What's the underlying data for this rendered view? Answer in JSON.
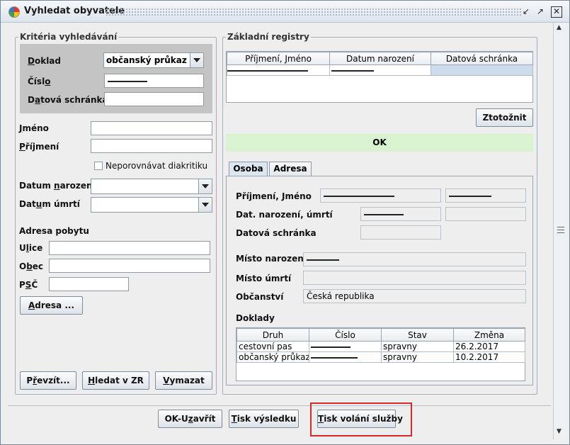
{
  "window": {
    "title": "Vyhledat obyvatele",
    "controls": [
      "minimize-icon",
      "restore-icon",
      "close-icon"
    ]
  },
  "criteria": {
    "legend": "Kritéria vyhledávání",
    "doklad_label": "Doklad",
    "doklad_value": "občanský průkaz",
    "cislo_label": "Číslo",
    "cislo_value": "[redacted]",
    "datova_schranka_label": "Datová schránka",
    "datova_schranka_value": "",
    "jmeno_label": "Jméno",
    "jmeno_value": "",
    "prijmeni_label": "Příjmení",
    "prijmeni_value": "",
    "diakritika_label": "Neporovnávat diakritiku",
    "diakritika_checked": false,
    "datum_narozeni_label": "Datum narození",
    "datum_narozeni_value": "",
    "datum_umrti_label": "Datum úmrtí",
    "datum_umrti_value": "",
    "adresa_pobytu_label": "Adresa pobytu",
    "ulice_label": "Ulice",
    "ulice_value": "",
    "obec_label": "Obec",
    "obec_value": "",
    "psc_label": "PSČ",
    "psc_value": "",
    "adresa_button": "Adresa ...",
    "prevzit_button": "Převzít...",
    "hledat_button": "Hledat v ZR",
    "vymazat_button": "Vymazat"
  },
  "registry": {
    "legend": "Základní registry",
    "columns": [
      "Příjmení, Jméno",
      "Datum narození",
      "Datová schránka"
    ],
    "rows": [
      {
        "name": "[redacted]",
        "birth": "[redacted]",
        "box": ""
      }
    ],
    "ztotoznit_button": "Ztotožnit",
    "status": "OK"
  },
  "tabs": [
    {
      "label": "Osoba",
      "active": true
    },
    {
      "label": "Adresa",
      "active": false
    }
  ],
  "person": {
    "prijmeni_jmeno_label": "Příjmení, Jméno",
    "prijmeni_value": "[redacted]",
    "jmeno_value": "[redacted]",
    "dat_label": "Dat. narození, úmrtí",
    "narozeni_value": "[redacted]",
    "umrti_value": "",
    "datova_schranka_label": "Datová schránka",
    "datova_schranka_value": "",
    "misto_narozeni_label": "Místo narození",
    "misto_narozeni_value": "[redacted]",
    "misto_umrti_label": "Místo úmrtí",
    "misto_umrti_value": "",
    "obcanstvi_label": "Občanství",
    "obcanstvi_value": "Česká republika",
    "doklady_label": "Doklady",
    "doklady_columns": [
      "Druh",
      "Číslo",
      "Stav",
      "Změna"
    ],
    "doklady_rows": [
      {
        "druh": "cestovní pas",
        "cislo": "[redacted]",
        "stav": "spravny",
        "zmena": "26.2.2017"
      },
      {
        "druh": "občanský průkaz",
        "cislo": "[redacted]",
        "stav": "spravny",
        "zmena": "10.2.2017"
      }
    ]
  },
  "footer": {
    "ok_button": "OK-Uzavřít",
    "tisk_vysledku_button": "Tisk výsledku",
    "tisk_volani_button": "Tisk volání služby"
  },
  "colors": {
    "highlight": "#d42a2a",
    "ok_bar": "#d9f2cf",
    "selected_row": "#cddcec"
  }
}
